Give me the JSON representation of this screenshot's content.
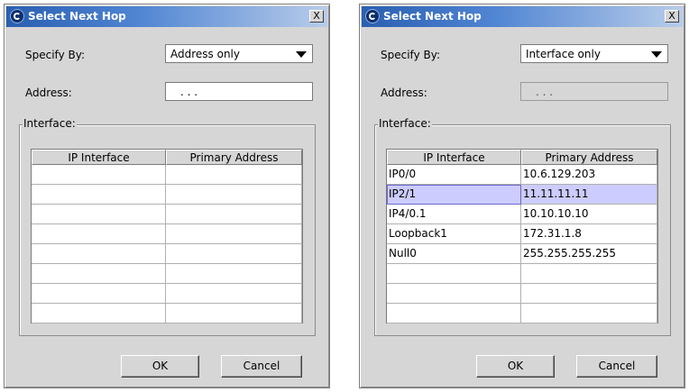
{
  "colors": {
    "window_bg": "#d6d6d6",
    "title_bar_start": "#2a5fb0",
    "title_bar_end": "#b8ccea",
    "selected_row": "#ccccff"
  },
  "dialogs": [
    {
      "title": "Select Next Hop",
      "close_label": "X",
      "specify_label": "Specify By:",
      "specify_value": "Address only",
      "address_label": "Address:",
      "address_value": ". . .",
      "address_enabled": true,
      "interface_group_label": "Interface:",
      "table": {
        "columns": [
          "IP Interface",
          "Primary Address"
        ],
        "rows": [
          [
            "",
            ""
          ],
          [
            "",
            ""
          ],
          [
            "",
            ""
          ],
          [
            "",
            ""
          ],
          [
            "",
            ""
          ],
          [
            "",
            ""
          ],
          [
            "",
            ""
          ],
          [
            "",
            ""
          ]
        ]
      },
      "ok_label": "OK",
      "cancel_label": "Cancel"
    },
    {
      "title": "Select Next Hop",
      "close_label": "X",
      "specify_label": "Specify By:",
      "specify_value": "Interface only",
      "address_label": "Address:",
      "address_value": ". . .",
      "address_enabled": false,
      "interface_group_label": "Interface:",
      "table": {
        "columns": [
          "IP Interface",
          "Primary Address"
        ],
        "selected_row": 1,
        "rows": [
          [
            "IP0/0",
            "10.6.129.203"
          ],
          [
            "IP2/1",
            "11.11.11.11"
          ],
          [
            "IP4/0.1",
            "10.10.10.10"
          ],
          [
            "Loopback1",
            "172.31.1.8"
          ],
          [
            "Null0",
            "255.255.255.255"
          ],
          [
            "",
            ""
          ],
          [
            "",
            ""
          ],
          [
            "",
            ""
          ]
        ]
      },
      "ok_label": "OK",
      "cancel_label": "Cancel"
    }
  ]
}
